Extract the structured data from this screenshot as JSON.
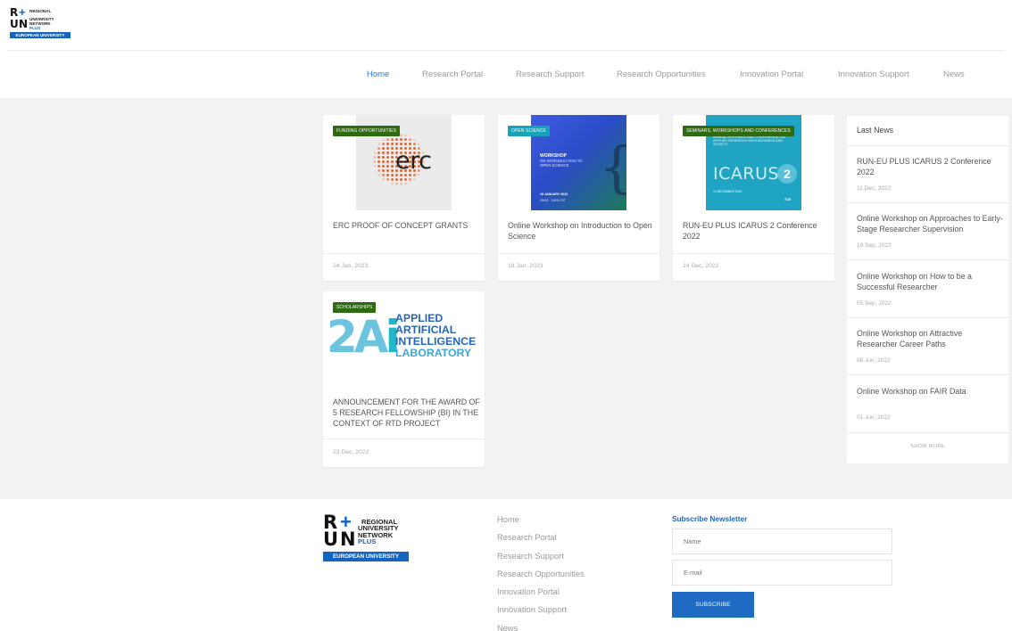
{
  "logo": {
    "letters": [
      "R",
      "U",
      "N"
    ],
    "plus_symbol": "+",
    "text_line1": "REGIONAL",
    "text_line2": "UNIVERSITY",
    "text_line3": "NETWORK",
    "text_line4": "PLUS",
    "band": "EUROPEAN UNIVERSITY",
    "accent_color": "#1565c0"
  },
  "nav": {
    "items": [
      "Home",
      "Research Portal",
      "Research Support",
      "Research Opportunities",
      "Innovation Portal",
      "Innovation Support",
      "News"
    ],
    "active": "Home"
  },
  "cards": [
    {
      "tag": "FUNDING OPPORTUNITIES",
      "title": "ERC PROOF OF CONCEPT GRANTS",
      "date": "24 Jan, 2023",
      "image_text": "erc"
    },
    {
      "tag": "OPEN SCIENCE",
      "title": "Online Workshop on Introduction to Open Science",
      "date": "18 Jan, 2023",
      "image_text": {
        "title": "WORKSHOP",
        "subtitle": "ON INTRODUCTION TO OPEN SCIENCE",
        "date": "18 JANUARY 2023",
        "time": "09H00 - 14H30 CET"
      }
    },
    {
      "tag": "SEMINARS, WORKSHOPS AND CONFERENCES",
      "title": "RUN-EU PLUS ICARUS 2 Conference 2022",
      "date": "14 Dec, 2022",
      "image_text": {
        "header": "ANNUAL INTERNATIONAL CONFERENCE ON APPLIED RESEARCH WITH BUSINESS AND SOCIETY",
        "word": "ICARUS",
        "number": "2",
        "date": "14 DECEMBER 2022",
        "logo": "TUS"
      }
    },
    {
      "tag": "SCHOLARSHIPS",
      "title": "ANNOUNCEMENT FOR THE AWARD OF 5 RESEARCH FELLOWSHIP (BI) IN THE CONTEXT OF RTD PROJECT",
      "date": "23 Dec, 2022",
      "image_text": {
        "mark": "2A",
        "mark_i": "i",
        "line1": "APPLIED",
        "line2": "ARTIFICIAL",
        "line3": "INTELLIGENCE",
        "line4": "LABORATORY"
      }
    }
  ],
  "news": {
    "heading": "Last News",
    "items": [
      {
        "title": "RUN-EU PLUS ICARUS 2 Conference 2022",
        "date": "11 Dec, 2022"
      },
      {
        "title": "Online Workshop on Approaches to Early-Stage Researcher Supervision",
        "date": "19 Sep, 2022"
      },
      {
        "title": "Online Workshop on How to be a Successful Researcher",
        "date": "05 Sep, 2022"
      },
      {
        "title": "Online Workshop on Attractive Researcher Career Paths",
        "date": "08 Jun, 2022"
      },
      {
        "title": "Online Workshop on FAIR Data",
        "date": "01 Jun, 2022"
      }
    ],
    "show_more": "SHOW MORE"
  },
  "footer": {
    "links": [
      "Home",
      "Research Portal",
      "Research Support",
      "Research Opportunities",
      "Innovation Portal",
      "Innovation Support",
      "News"
    ],
    "newsletter_title": "Subscribe Newsletter",
    "name_placeholder": "Name",
    "email_placeholder": "E-mail",
    "subscribe_label": "SUBSCRIBE"
  }
}
